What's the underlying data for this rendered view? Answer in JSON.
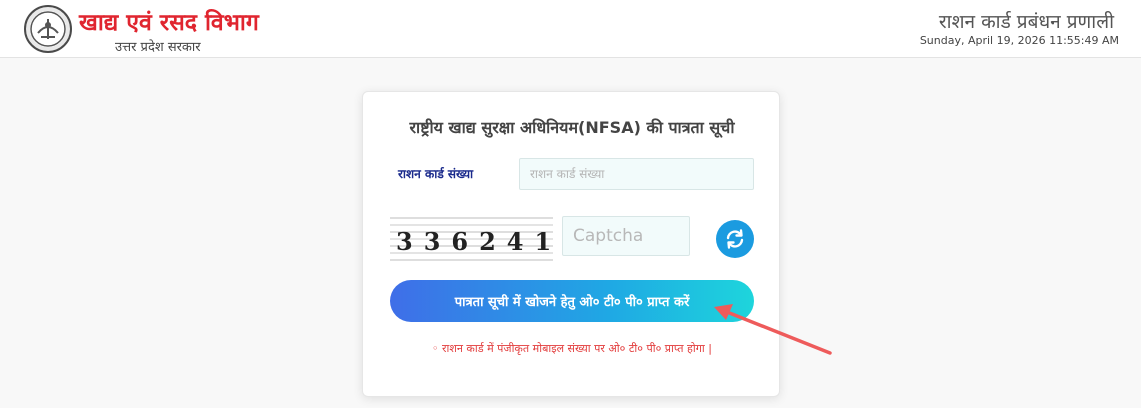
{
  "header": {
    "dept_title": "खाद्य एवं रसद विभाग",
    "dept_subtitle": "उत्तर प्रदेश सरकार",
    "system_title": "राशन कार्ड प्रबंधन प्रणाली",
    "datetime": "Sunday, April 19, 2026 11:55:49 AM",
    "logo_icon": "up-govt-emblem-icon"
  },
  "form": {
    "title": "राष्ट्रीय खाद्य सुरक्षा अधिनियम(NFSA) की पात्रता सूची",
    "ration_card_label": "राशन कार्ड संख्या",
    "ration_card_placeholder": "राशन कार्ड संख्या",
    "ration_card_value": "",
    "captcha_text": "336241",
    "captcha_placeholder": "Captcha",
    "captcha_value": "",
    "refresh_icon": "refresh-icon",
    "submit_label": "पात्रता सूची में खोजने हेतु ओ० टी० पी० प्राप्त करें",
    "note": "◦  राशन कार्ड में पंजीकृत मोबाइल संख्या पर ओ० टी० पी० प्राप्त होगा |"
  },
  "colors": {
    "title_red": "#e0252f",
    "label_blue": "#1a2a8c",
    "button_gradient_start": "#3f6ee8",
    "button_gradient_end": "#1ed5dc",
    "refresh_blue": "#1b9be0",
    "note_red": "#e23b3b",
    "annotation_arrow": "#ee5b5b"
  }
}
